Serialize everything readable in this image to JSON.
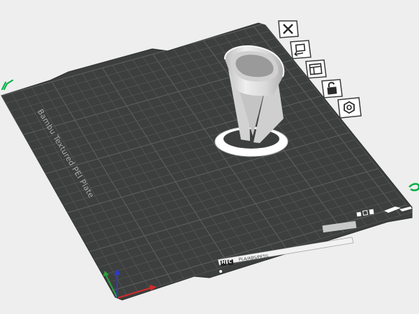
{
  "plate": {
    "name": "Bambu Textured PEI Plate",
    "filament_types": "PLA/ABS/PETG",
    "badges": [
      "H",
      "C"
    ]
  },
  "toolbar": {
    "buttons": [
      {
        "name": "delete-plate-button",
        "icon": "close-icon"
      },
      {
        "name": "arrange-button",
        "icon": "arrange-icon"
      },
      {
        "name": "orient-button",
        "icon": "layout-icon"
      },
      {
        "name": "lock-plate-button",
        "icon": "lock-icon"
      },
      {
        "name": "plate-settings-button",
        "icon": "settings-icon"
      }
    ]
  },
  "colors": {
    "background": "#eeeeee",
    "plate": "#3d3f3f",
    "grid_line": "#5a5c5c",
    "model": "#e6e6e6",
    "axis_x": "#d42a2a",
    "axis_y": "#2aa33a",
    "axis_z": "#2a3ad4",
    "accent": "#00ae42"
  }
}
